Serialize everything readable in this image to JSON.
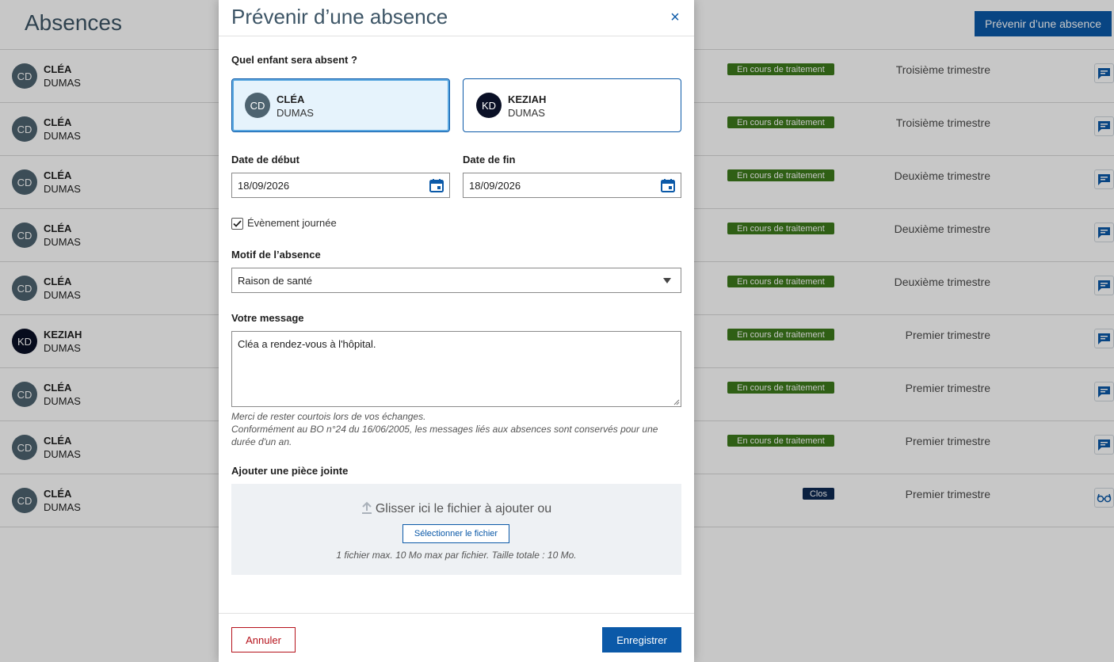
{
  "page": {
    "title": "Absences",
    "new_absence_button": "Prévenir d’une absence"
  },
  "absences": [
    {
      "initials": "CD",
      "first": "CLÉA",
      "last": "DUMAS",
      "status": "En cours de traitement",
      "term": "Troisième trimestre",
      "action_icon": "message-icon"
    },
    {
      "initials": "CD",
      "first": "CLÉA",
      "last": "DUMAS",
      "status": "En cours de traitement",
      "term": "Troisième trimestre",
      "action_icon": "message-icon"
    },
    {
      "initials": "CD",
      "first": "CLÉA",
      "last": "DUMAS",
      "status": "En cours de traitement",
      "term": "Deuxième trimestre",
      "action_icon": "message-icon"
    },
    {
      "initials": "CD",
      "first": "CLÉA",
      "last": "DUMAS",
      "status": "En cours de traitement",
      "term": "Deuxième trimestre",
      "action_icon": "message-icon"
    },
    {
      "initials": "CD",
      "first": "CLÉA",
      "last": "DUMAS",
      "status": "En cours de traitement",
      "term": "Deuxième trimestre",
      "action_icon": "message-icon"
    },
    {
      "initials": "KD",
      "first": "KEZIAH",
      "last": "DUMAS",
      "status": "En cours de traitement",
      "term": "Premier trimestre",
      "action_icon": "message-icon"
    },
    {
      "initials": "CD",
      "first": "CLÉA",
      "last": "DUMAS",
      "status": "En cours de traitement",
      "term": "Premier trimestre",
      "action_icon": "message-icon"
    },
    {
      "initials": "CD",
      "first": "CLÉA",
      "last": "DUMAS",
      "status": "En cours de traitement",
      "term": "Premier trimestre",
      "action_icon": "message-icon"
    },
    {
      "initials": "CD",
      "first": "CLÉA",
      "last": "DUMAS",
      "status": "Clos",
      "term": "Premier trimestre",
      "action_icon": "glasses-icon"
    }
  ],
  "modal": {
    "title": "Prévenir d’une absence",
    "close_label": "×",
    "child_question": "Quel enfant sera absent ?",
    "children": [
      {
        "initials": "CD",
        "first": "CLÉA",
        "last": "DUMAS",
        "selected": true
      },
      {
        "initials": "KD",
        "first": "KEZIAH",
        "last": "DUMAS",
        "selected": false
      }
    ],
    "start_label": "Date de début",
    "start_value": "18/09/2026",
    "end_label": "Date de fin",
    "end_value": "18/09/2026",
    "all_day_label": "Évènement journée",
    "all_day_checked": true,
    "reason_label": "Motif de l’absence",
    "reason_value": "Raison de santé",
    "message_label": "Votre message",
    "message_value": "Cléa a rendez-vous à l'hôpital.",
    "hint_line1": "Merci de rester courtois lors de vos échanges.",
    "hint_line2": "Conformément au BO n°24 du 16/06/2005, les messages liés aux absences sont conservés pour une durée d'un an.",
    "attachment_label": "Ajouter une pièce jointe",
    "dropzone_text": "Glisser ici le fichier à ajouter ou",
    "select_file_button": "Sélectionner le fichier",
    "file_limits": "1 fichier max. 10 Mo max par fichier. Taille totale : 10 Mo.",
    "cancel_button": "Annuler",
    "save_button": "Enregistrer"
  },
  "colors": {
    "primary": "#0b59a8",
    "status_in_progress": "#3d7a1c",
    "status_closed": "#0e2a52",
    "cancel": "#b5121b"
  }
}
